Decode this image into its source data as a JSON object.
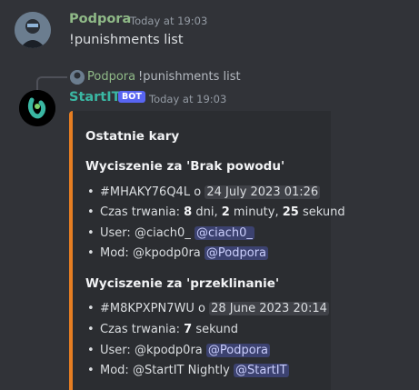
{
  "message1": {
    "author": "Podpora",
    "author_color": "#8fb987",
    "timestamp": "Today at 19:03",
    "content": "!punishments list"
  },
  "reply": {
    "author": "Podpora",
    "content": "!punishments list"
  },
  "message2": {
    "author": "StartIT",
    "author_color": "#3ab7a3",
    "bot_badge": "BOT",
    "timestamp": "Today at 19:03"
  },
  "embed": {
    "accent_color": "#e67e22",
    "title": "Ostatnie kary",
    "entries": [
      {
        "heading": "Wyciszenie za 'Brak powodu'",
        "id": "#MHAKY76Q4L",
        "o": "o",
        "date": "24 July 2023 01:26",
        "duration_label": "Czas trwania:",
        "duration_parts": [
          "8",
          "dni,",
          "2",
          "minuty,",
          "25",
          "sekund"
        ],
        "user_label": "User:",
        "user_name": "@ciach0_",
        "user_mention": "@ciach0_",
        "mod_label": "Mod:",
        "mod_name": "@kpodp0ra",
        "mod_mention": "@Podpora"
      },
      {
        "heading": "Wyciszenie za 'przeklinanie'",
        "id": "#M8KPXPN7WU",
        "o": "o",
        "date": "28 June 2023 20:14",
        "duration_label": "Czas trwania:",
        "duration_parts": [
          "7",
          "sekund"
        ],
        "user_label": "User:",
        "user_name": "@kpodp0ra",
        "user_mention": "@Podpora",
        "mod_label": "Mod:",
        "mod_name": "@StartIT Nightly",
        "mod_mention": "@StartIT"
      }
    ]
  }
}
